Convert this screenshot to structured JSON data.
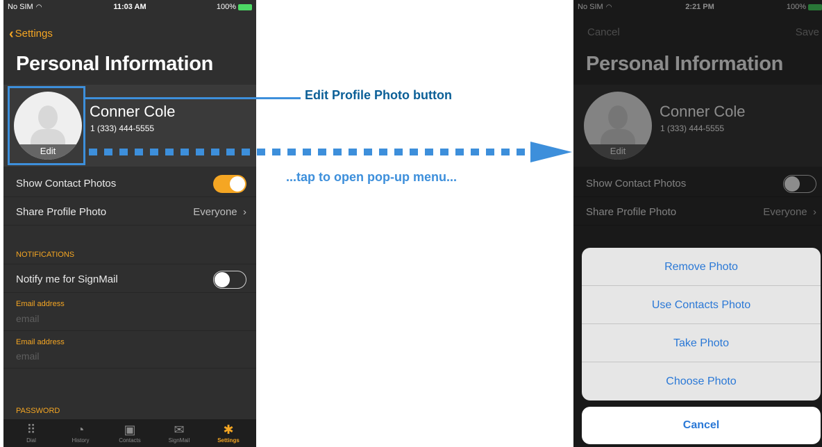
{
  "left": {
    "status": {
      "carrier": "No SIM",
      "time": "11:03 AM",
      "battery": "100%"
    },
    "back_label": "Settings",
    "title": "Personal Information",
    "profile": {
      "name": "Conner Cole",
      "phone": "1 (333) 444-5555",
      "edit_label": "Edit"
    },
    "show_contact_photos": {
      "label": "Show Contact Photos",
      "on": true
    },
    "share_profile_photo": {
      "label": "Share Profile Photo",
      "value": "Everyone"
    },
    "notifications_header": "NOTIFICATIONS",
    "notify_signmail": {
      "label": "Notify me for SignMail",
      "on": false
    },
    "email_fields": [
      {
        "label": "Email address",
        "placeholder": "email"
      },
      {
        "label": "Email address",
        "placeholder": "email"
      }
    ],
    "password_header": "PASSWORD",
    "tabs": [
      {
        "label": "Dial",
        "icon": "keypad-icon"
      },
      {
        "label": "History",
        "icon": "clock-icon"
      },
      {
        "label": "Contacts",
        "icon": "contacts-book-icon"
      },
      {
        "label": "SignMail",
        "icon": "envelope-icon"
      },
      {
        "label": "Settings",
        "icon": "gear-icon",
        "active": true
      }
    ]
  },
  "annotations": {
    "edit_photo_label": "Edit Profile Photo button",
    "tap_label": "...tap to open pop-up menu..."
  },
  "right": {
    "status": {
      "carrier": "No SIM",
      "time": "2:21 PM",
      "battery": "100%"
    },
    "cancel_label": "Cancel",
    "save_label": "Save",
    "title": "Personal Information",
    "profile": {
      "name": "Conner Cole",
      "phone": "1 (333) 444-5555",
      "edit_label": "Edit"
    },
    "show_contact_photos": {
      "label": "Show Contact Photos",
      "on": false
    },
    "share_profile_photo": {
      "label": "Share Profile Photo",
      "value": "Everyone"
    },
    "action_sheet": {
      "items": [
        "Remove Photo",
        "Use Contacts Photo",
        "Take Photo",
        "Choose Photo"
      ],
      "cancel": "Cancel"
    }
  },
  "colors": {
    "accent": "#f5a623",
    "annotation_blue": "#3d8fdb",
    "action_blue": "#2a78d6"
  }
}
